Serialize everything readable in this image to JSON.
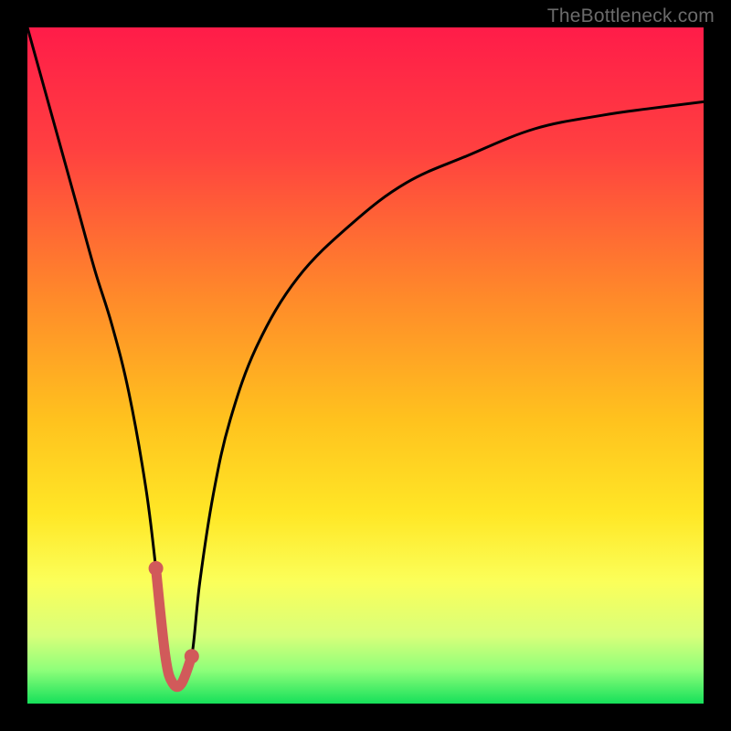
{
  "watermark": "TheBottleneck.com",
  "colors": {
    "frame": "#000000",
    "watermark": "#6b6b6b",
    "curve": "#000000",
    "highlight_stroke": "#d15a5a",
    "highlight_dot": "#d15a5a",
    "gradient_stops": [
      {
        "offset": 0.0,
        "color": "#ff1c49"
      },
      {
        "offset": 0.18,
        "color": "#ff4040"
      },
      {
        "offset": 0.4,
        "color": "#ff8a2a"
      },
      {
        "offset": 0.58,
        "color": "#ffc21e"
      },
      {
        "offset": 0.72,
        "color": "#ffe726"
      },
      {
        "offset": 0.82,
        "color": "#fbff5a"
      },
      {
        "offset": 0.9,
        "color": "#d8ff7a"
      },
      {
        "offset": 0.95,
        "color": "#8fff7a"
      },
      {
        "offset": 1.0,
        "color": "#16e05a"
      }
    ]
  },
  "chart_data": {
    "type": "line",
    "title": "",
    "xlabel": "",
    "ylabel": "",
    "xlim": [
      0,
      100
    ],
    "ylim": [
      0,
      100
    ],
    "grid": false,
    "series": [
      {
        "name": "bottleneck-curve",
        "x": [
          0.0,
          2.5,
          5.0,
          7.5,
          10.0,
          12.5,
          15.0,
          17.5,
          19.0,
          20.4,
          21.5,
          22.8,
          24.3,
          25.5,
          27.5,
          30.0,
          34.0,
          40.0,
          48.0,
          56.0,
          65.0,
          75.0,
          85.0,
          92.0,
          100.0
        ],
        "y": [
          100,
          91,
          82,
          73,
          64,
          56,
          46,
          32,
          20,
          7,
          3,
          3,
          7,
          18,
          31,
          42,
          53,
          63,
          71,
          77,
          81,
          85,
          87,
          88,
          89
        ]
      }
    ],
    "annotations": [
      {
        "name": "optimal-range",
        "type": "highlight-segment",
        "x": [
          19.0,
          20.4,
          21.5,
          22.8,
          24.3
        ],
        "y": [
          20,
          7,
          3,
          3,
          7
        ]
      }
    ],
    "legend": false
  }
}
